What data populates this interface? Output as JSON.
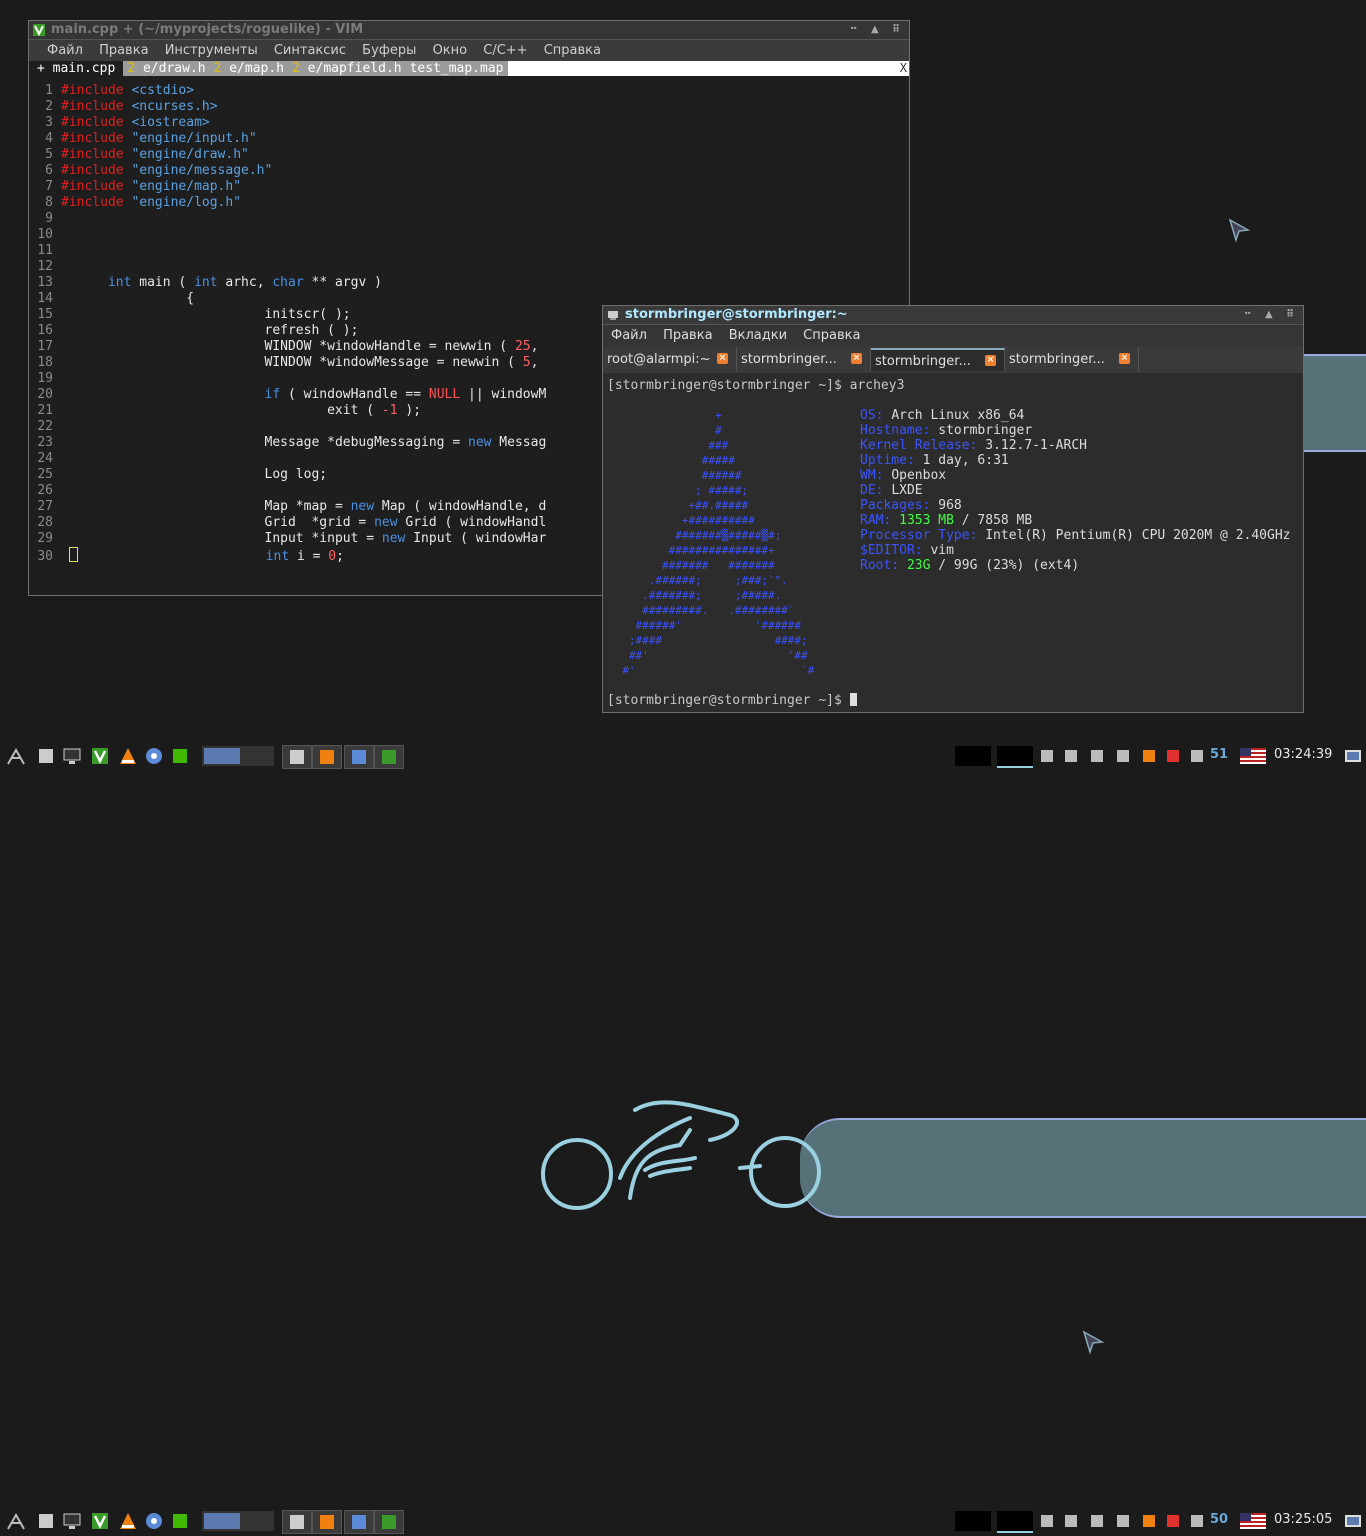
{
  "vim": {
    "title": "main.cpp + (~/myprojects/roguelike) - VIM",
    "menu": [
      "Файл",
      "Правка",
      "Инструменты",
      "Синтаксис",
      "Буферы",
      "Окно",
      "C/C++",
      "Справка"
    ],
    "tabs": {
      "active": "+ main.cpp",
      "others": [
        {
          "num": "2",
          "name": "e/draw.h"
        },
        {
          "num": "2",
          "name": "e/map.h"
        },
        {
          "num": "2",
          "name": "e/mapfield.h"
        },
        {
          "num": "",
          "name": "test_map.map"
        }
      ],
      "close": "X"
    },
    "code": [
      {
        "n": "1",
        "inc": "#include",
        "arg": "<cstdio>"
      },
      {
        "n": "2",
        "inc": "#include",
        "arg": "<ncurses.h>"
      },
      {
        "n": "3",
        "inc": "#include",
        "arg": "<iostream>"
      },
      {
        "n": "4",
        "inc": "#include",
        "arg": "\"engine/input.h\""
      },
      {
        "n": "5",
        "inc": "#include",
        "arg": "\"engine/draw.h\""
      },
      {
        "n": "6",
        "inc": "#include",
        "arg": "\"engine/message.h\""
      },
      {
        "n": "7",
        "inc": "#include",
        "arg": "\"engine/map.h\""
      },
      {
        "n": "8",
        "inc": "#include",
        "arg": "\"engine/log.h\""
      }
    ],
    "lines": {
      "l13": "int main ( int arhc, char ** argv )",
      "l14": "{",
      "l15": "initscr( );",
      "l16": "refresh ( );",
      "l17": "WINDOW *windowHandle = newwin ( 25,",
      "l18": "WINDOW *windowMessage = newwin ( 5,",
      "l20a": "if ( windowHandle == ",
      "l20null": "NULL",
      "l20b": " || windowM",
      "l21": "exit ( -1 );",
      "l23": "Message *debugMessaging = new Messag",
      "l25": "Log log;",
      "l27": "Map *map = new Map ( windowHandle, d",
      "l28": "Grid  *grid = new Grid ( windowHandl",
      "l29": "Input *input = new Input ( windowHar",
      "l30": "int i = 0;"
    }
  },
  "terminal": {
    "title": "stormbringer@stormbringer:~",
    "menu": [
      "Файл",
      "Правка",
      "Вкладки",
      "Справка"
    ],
    "tabs": [
      "root@alarmpi:~",
      "stormbringer...",
      "stormbringer...",
      "stormbringer..."
    ],
    "prompt1": "[stormbringer@stormbringer ~]$ archey3",
    "prompt2": "[stormbringer@stormbringer ~]$ ",
    "ascii": "                +\n                #\n               ###\n              #####\n              ######\n             ; #####;\n            +##.#####\n           +##########\n          #######▒#####▒#;\n         ###############+\n        #######   #######\n      .######;     ;###;`\".\n     .#######;     ;#####.\n     #########.   .########`\n    ######'           '######\n   ;####                 ####;\n   ##'                     '##\n  #'                         `#",
    "info": [
      {
        "k": "OS:",
        "v": "Arch Linux x86_64"
      },
      {
        "k": "Hostname:",
        "v": "stormbringer"
      },
      {
        "k": "Kernel Release:",
        "v": "3.12.7-1-ARCH"
      },
      {
        "k": "Uptime:",
        "v": "1 day, 6:31"
      },
      {
        "k": "WM:",
        "v": "Openbox"
      },
      {
        "k": "DE:",
        "v": "LXDE"
      },
      {
        "k": "Packages:",
        "v": "968"
      },
      {
        "k": "RAM:",
        "g": "1353 MB",
        "v": "/ 7858 MB"
      },
      {
        "k": "Processor Type:",
        "v": "Intel(R) Pentium(R) CPU 2020M @ 2.40GHz"
      },
      {
        "k": "$EDITOR:",
        "v": "vim"
      },
      {
        "k": "Root:",
        "g": "23G",
        "v": "/ 99G (23%) (ext4)"
      }
    ]
  },
  "panel_top": {
    "desk": "51",
    "clock": "03:24:39"
  },
  "panel_bottom": {
    "desk": "50",
    "clock": "03:25:05"
  },
  "colors": {
    "accent": "#9ad0e0",
    "stripe": "#567178",
    "bg": "#1b1b1b"
  }
}
